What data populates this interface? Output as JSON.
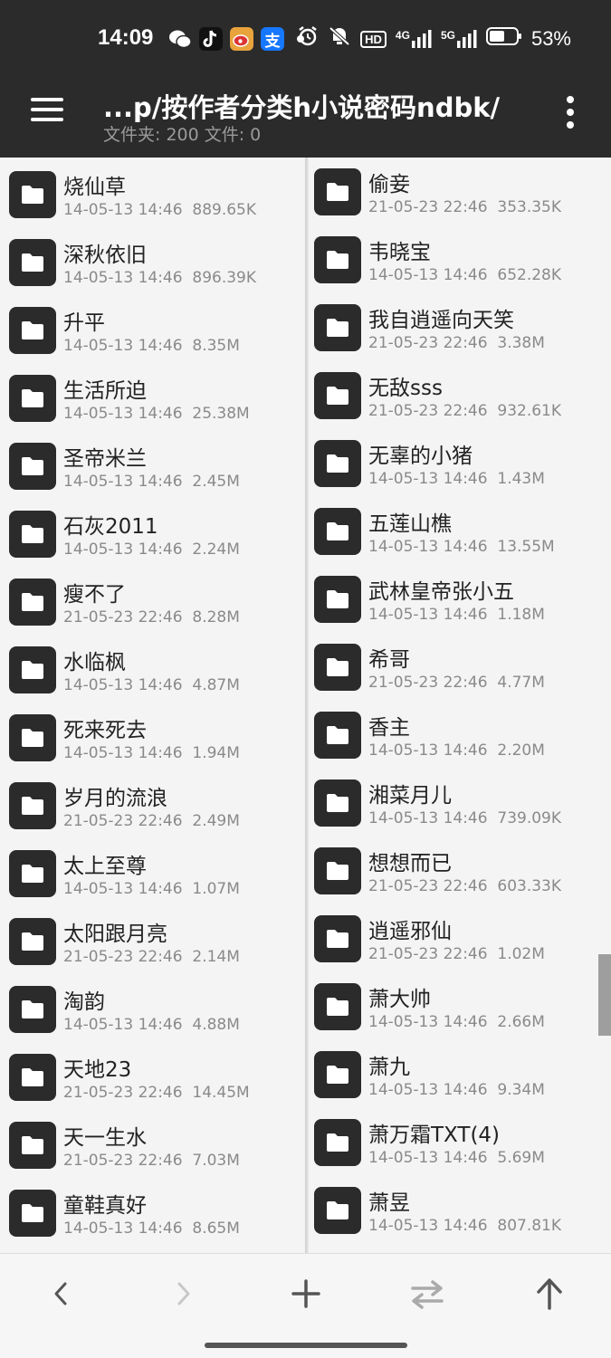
{
  "status_bar": {
    "time": "14:09",
    "app_icons": [
      "wechat-icon",
      "tiktok-icon",
      "weibo-icon",
      "alipay-icon"
    ],
    "network_hd": "HD",
    "signal_4g": "4G",
    "signal_5g": "5G",
    "battery_percent": "53%"
  },
  "toolbar": {
    "path": "...p/按作者分类h小说密码ndbk/",
    "summary": "文件夹: 200  文件: 0"
  },
  "folders_left": [
    {
      "name": "烧仙草",
      "date": "14-05-13 14:46",
      "size": "889.65K"
    },
    {
      "name": "深秋依旧",
      "date": "14-05-13 14:46",
      "size": "896.39K"
    },
    {
      "name": "升平",
      "date": "14-05-13 14:46",
      "size": "8.35M"
    },
    {
      "name": "生活所迫",
      "date": "14-05-13 14:46",
      "size": "25.38M"
    },
    {
      "name": "圣帝米兰",
      "date": "14-05-13 14:46",
      "size": "2.45M"
    },
    {
      "name": "石灰2011",
      "date": "14-05-13 14:46",
      "size": "2.24M"
    },
    {
      "name": "瘦不了",
      "date": "21-05-23 22:46",
      "size": "8.28M"
    },
    {
      "name": "水临枫",
      "date": "14-05-13 14:46",
      "size": "4.87M"
    },
    {
      "name": "死来死去",
      "date": "14-05-13 14:46",
      "size": "1.94M"
    },
    {
      "name": "岁月的流浪",
      "date": "21-05-23 22:46",
      "size": "2.49M"
    },
    {
      "name": "太上至尊",
      "date": "14-05-13 14:46",
      "size": "1.07M"
    },
    {
      "name": "太阳跟月亮",
      "date": "21-05-23 22:46",
      "size": "2.14M"
    },
    {
      "name": "淘韵",
      "date": "14-05-13 14:46",
      "size": "4.88M"
    },
    {
      "name": "天地23",
      "date": "21-05-23 22:46",
      "size": "14.45M"
    },
    {
      "name": "天一生水",
      "date": "21-05-23 22:46",
      "size": "7.03M"
    },
    {
      "name": "童鞋真好",
      "date": "14-05-13 14:46",
      "size": "8.65M"
    }
  ],
  "folders_right": [
    {
      "name": "偷妾",
      "date": "21-05-23 22:46",
      "size": "353.35K"
    },
    {
      "name": "韦晓宝",
      "date": "14-05-13 14:46",
      "size": "652.28K"
    },
    {
      "name": "我自逍遥向天笑",
      "date": "21-05-23 22:46",
      "size": "3.38M"
    },
    {
      "name": "无敌sss",
      "date": "21-05-23 22:46",
      "size": "932.61K"
    },
    {
      "name": "无辜的小猪",
      "date": "14-05-13 14:46",
      "size": "1.43M"
    },
    {
      "name": "五莲山樵",
      "date": "14-05-13 14:46",
      "size": "13.55M"
    },
    {
      "name": "武林皇帝张小五",
      "date": "14-05-13 14:46",
      "size": "1.18M"
    },
    {
      "name": "希哥",
      "date": "21-05-23 22:46",
      "size": "4.77M"
    },
    {
      "name": "香主",
      "date": "14-05-13 14:46",
      "size": "2.20M"
    },
    {
      "name": "湘菜月儿",
      "date": "14-05-13 14:46",
      "size": "739.09K"
    },
    {
      "name": "想想而已",
      "date": "21-05-23 22:46",
      "size": "603.33K"
    },
    {
      "name": "逍遥邪仙",
      "date": "21-05-23 22:46",
      "size": "1.02M"
    },
    {
      "name": "萧大帅",
      "date": "14-05-13 14:46",
      "size": "2.66M"
    },
    {
      "name": "萧九",
      "date": "14-05-13 14:46",
      "size": "9.34M"
    },
    {
      "name": "萧万霜TXT(4)",
      "date": "14-05-13 14:46",
      "size": "5.69M"
    },
    {
      "name": "萧昱",
      "date": "14-05-13 14:46",
      "size": "807.81K"
    }
  ],
  "bottom_nav": [
    "back-icon",
    "forward-icon",
    "add-icon",
    "swap-icon",
    "up-icon"
  ],
  "colors": {
    "bar": "#2b2b2b",
    "background": "#f4f4f4",
    "text": "#222222",
    "meta": "#8a8a8a"
  }
}
